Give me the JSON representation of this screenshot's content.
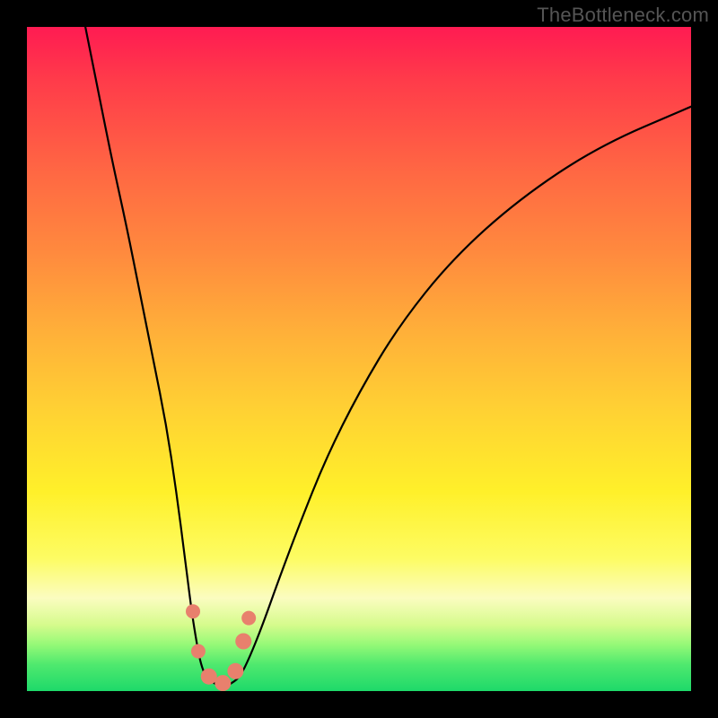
{
  "watermark": "TheBottleneck.com",
  "chart_data": {
    "type": "line",
    "title": "",
    "curve_description": "V-shaped bottleneck curve: steep descent on the left branch to a trough near the bottom, rising more gently on the right branch; a cluster of salmon-colored markers sits around the trough",
    "left_branch": [
      {
        "x": 0.088,
        "y": 1.0
      },
      {
        "x": 0.108,
        "y": 0.9
      },
      {
        "x": 0.128,
        "y": 0.8
      },
      {
        "x": 0.15,
        "y": 0.7
      },
      {
        "x": 0.17,
        "y": 0.6
      },
      {
        "x": 0.19,
        "y": 0.5
      },
      {
        "x": 0.21,
        "y": 0.4
      },
      {
        "x": 0.225,
        "y": 0.3
      },
      {
        "x": 0.238,
        "y": 0.2
      },
      {
        "x": 0.248,
        "y": 0.12
      },
      {
        "x": 0.256,
        "y": 0.07
      },
      {
        "x": 0.262,
        "y": 0.04
      },
      {
        "x": 0.27,
        "y": 0.02
      },
      {
        "x": 0.285,
        "y": 0.01
      }
    ],
    "right_branch": [
      {
        "x": 0.305,
        "y": 0.01
      },
      {
        "x": 0.32,
        "y": 0.02
      },
      {
        "x": 0.335,
        "y": 0.05
      },
      {
        "x": 0.355,
        "y": 0.1
      },
      {
        "x": 0.38,
        "y": 0.17
      },
      {
        "x": 0.41,
        "y": 0.25
      },
      {
        "x": 0.45,
        "y": 0.35
      },
      {
        "x": 0.5,
        "y": 0.45
      },
      {
        "x": 0.56,
        "y": 0.55
      },
      {
        "x": 0.64,
        "y": 0.65
      },
      {
        "x": 0.74,
        "y": 0.74
      },
      {
        "x": 0.86,
        "y": 0.82
      },
      {
        "x": 1.0,
        "y": 0.88
      }
    ],
    "markers": [
      {
        "x": 0.25,
        "y": 0.12,
        "r": 8
      },
      {
        "x": 0.258,
        "y": 0.06,
        "r": 8
      },
      {
        "x": 0.274,
        "y": 0.022,
        "r": 9
      },
      {
        "x": 0.295,
        "y": 0.012,
        "r": 9
      },
      {
        "x": 0.314,
        "y": 0.03,
        "r": 9
      },
      {
        "x": 0.326,
        "y": 0.075,
        "r": 9
      },
      {
        "x": 0.334,
        "y": 0.11,
        "r": 8
      }
    ],
    "marker_color": "#e8806d",
    "curve_color": "#000000",
    "xlim": [
      0,
      1
    ],
    "ylim": [
      0,
      1
    ]
  }
}
